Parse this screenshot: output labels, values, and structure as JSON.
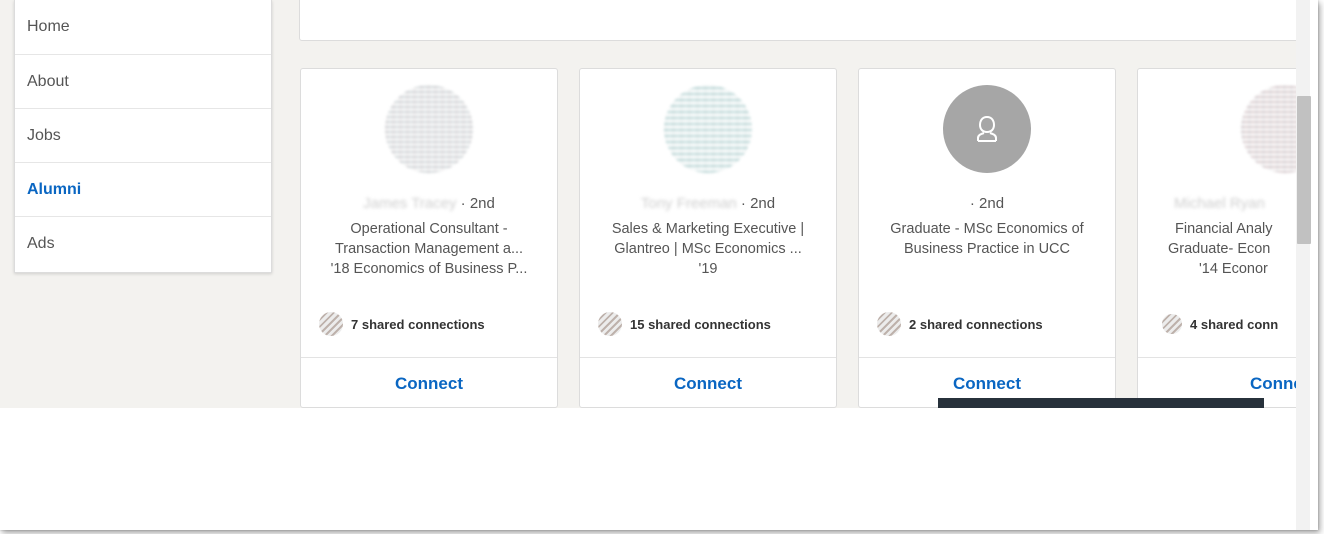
{
  "sidebar": {
    "items": [
      {
        "label": "Home",
        "active": false
      },
      {
        "label": "About",
        "active": false
      },
      {
        "label": "Jobs",
        "active": false
      },
      {
        "label": "Alumni",
        "active": true
      },
      {
        "label": "Ads",
        "active": false
      }
    ]
  },
  "cards": [
    {
      "name": "James Tracey",
      "degree": "· 2nd",
      "headline": [
        "Operational Consultant -",
        "Transaction Management a...",
        "'18 Economics of Business P..."
      ],
      "shared": "7 shared connections",
      "connect": "Connect"
    },
    {
      "name": "Tony Freeman",
      "degree": "· 2nd",
      "headline": [
        "Sales & Marketing Executive |",
        "Glantreo | MSc Economics ...",
        "'19"
      ],
      "shared": "15 shared connections",
      "connect": "Connect"
    },
    {
      "name": "",
      "degree": "· 2nd",
      "headline": [
        "Graduate - MSc Economics of",
        "Business Practice in UCC"
      ],
      "shared": "2 shared connections",
      "connect": "Connect"
    },
    {
      "name": "Michael Ryan",
      "degree": "",
      "headline": [
        "Financial Analy",
        "Graduate- Econ",
        "'14 Econor"
      ],
      "shared": "4 shared conn",
      "connect": "Connect"
    }
  ],
  "colors": {
    "accent": "#0a66c2",
    "page_bg": "#f3f2ef"
  },
  "icons": {
    "ghost_avatar": "person-outline-icon"
  }
}
